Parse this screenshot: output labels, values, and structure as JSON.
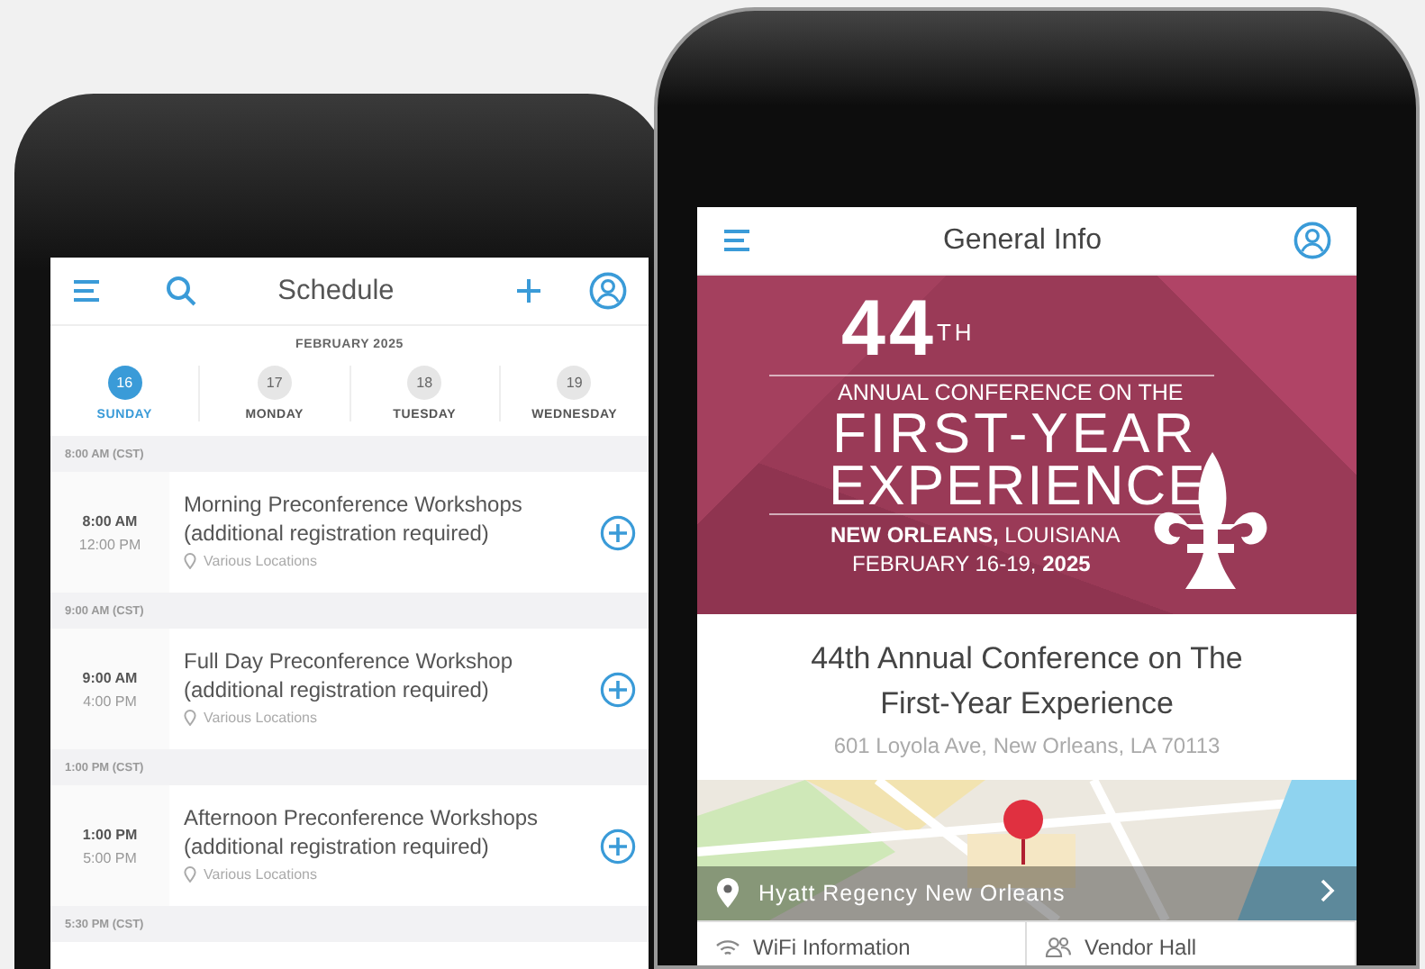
{
  "schedule_screen": {
    "title": "Schedule",
    "month": "FEBRUARY 2025",
    "days": [
      {
        "number": "16",
        "name": "SUNDAY",
        "selected": true
      },
      {
        "number": "17",
        "name": "MONDAY",
        "selected": false
      },
      {
        "number": "18",
        "name": "TUESDAY",
        "selected": false
      },
      {
        "number": "19",
        "name": "WEDNESDAY",
        "selected": false
      }
    ],
    "sections": [
      {
        "header": "8:00 AM (CST)",
        "items": [
          {
            "start": "8:00 AM",
            "end": "12:00 PM",
            "title": "Morning Preconference Workshops (additional registration required)",
            "location": "Various Locations"
          }
        ]
      },
      {
        "header": "9:00 AM (CST)",
        "items": [
          {
            "start": "9:00 AM",
            "end": "4:00 PM",
            "title": "Full Day Preconference Workshop (additional registration required)",
            "location": "Various Locations"
          }
        ]
      },
      {
        "header": "1:00 PM (CST)",
        "items": [
          {
            "start": "1:00 PM",
            "end": "5:00 PM",
            "title": "Afternoon Preconference Workshops (additional registration required)",
            "location": "Various Locations"
          }
        ]
      },
      {
        "header": "5:30 PM (CST)"
      }
    ]
  },
  "info_screen": {
    "title": "General Info",
    "banner": {
      "number": "44$^{TH}$",
      "subtitle": "ANNUAL CONFERENCE ON THE",
      "headline_1": "FIRST-YEAR",
      "headline_2": "EXPERIENCE",
      "place": "**NEW ORLEANS,** LOUISIANA",
      "dates": "FEBRUARY 16-19, **2025**"
    },
    "event_title": "44th Annual Conference on The First-Year Experience",
    "address": "601 Loyola Ave, New Orleans, LA 70113",
    "map": {
      "kind": "picture",
      "place_label": "Hyatt Regency New Orleans"
    },
    "tiles": [
      {
        "kind": "wifi",
        "label": "WiFi Information"
      },
      {
        "kind": "people",
        "label": "Vendor Hall"
      }
    ]
  }
}
